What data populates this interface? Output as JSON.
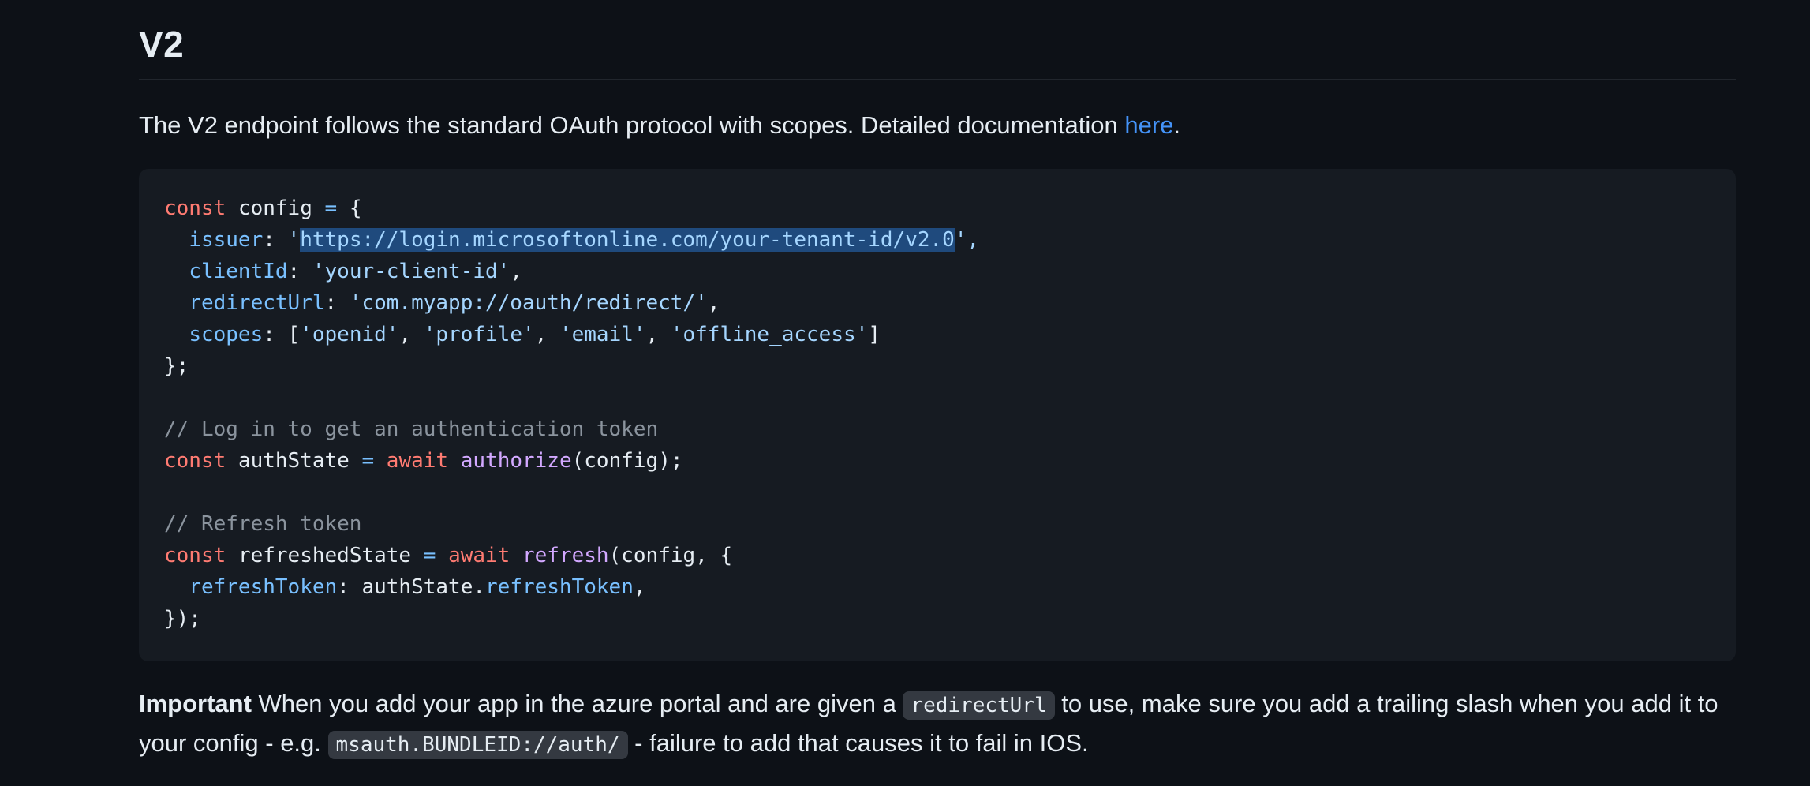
{
  "section": {
    "heading": "V2"
  },
  "intro": {
    "text": "The V2 endpoint follows the standard OAuth protocol with scopes. Detailed documentation ",
    "link_text": "here",
    "trailing": "."
  },
  "code": {
    "const_kw": "const",
    "await_kw": "await",
    "config_var": "config",
    "eq": "=",
    "open_brace": "{",
    "issuer_key": "issuer",
    "issuer_quote_open": "'",
    "issuer_url": "https://login.microsoftonline.com/your-tenant-id/v2.0",
    "issuer_quote_close": "',",
    "clientId_key": "clientId",
    "clientId_value": "'your-client-id'",
    "redirectUrl_key": "redirectUrl",
    "redirectUrl_value": "'com.myapp://oauth/redirect/'",
    "scopes_key": "scopes",
    "scope_openid": "'openid'",
    "scope_profile": "'profile'",
    "scope_email": "'email'",
    "scope_offline": "'offline_access'",
    "close_obj": "};",
    "comment_login": "// Log in to get an authentication token",
    "authState_var": "authState",
    "authorize_fn": "authorize",
    "authorize_args": "(config);",
    "comment_refresh": "// Refresh token",
    "refreshedState_var": "refreshedState",
    "refresh_fn": "refresh",
    "refresh_args": "(config, {",
    "refreshToken_key": "refreshToken",
    "authState_ref": "authState.",
    "refreshToken_prop": "refreshToken",
    "close_call": "});"
  },
  "note": {
    "bold": "Important",
    "text_1": " When you add your app in the azure portal and are given a ",
    "code_1": "redirectUrl",
    "text_2": " to use, make sure you add a trailing slash when you add it to your config - e.g. ",
    "code_2": "msauth.BUNDLEID://auth/",
    "text_3": " - failure to add that causes it to fail in IOS."
  },
  "colors": {
    "background": "#0d1117",
    "code_background": "#161b22",
    "keyword": "#ff7b72",
    "property": "#79c0ff",
    "string": "#a5d6ff",
    "function": "#d2a8ff",
    "comment": "#8b949e",
    "link": "#4493f8",
    "selection": "#1f4a7d"
  }
}
